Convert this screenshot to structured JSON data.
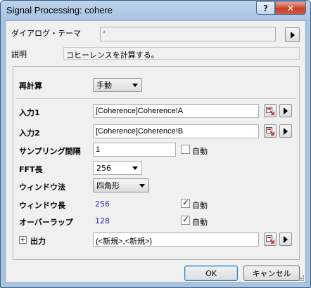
{
  "window": {
    "title": "Signal Processing: cohere",
    "help_glyph": "?",
    "close_glyph": "✕"
  },
  "theme": {
    "label": "ダイアログ・テーマ",
    "value": "*"
  },
  "description": {
    "label": "説明",
    "text": "コヒーレンスを計算する。"
  },
  "recalc": {
    "label": "再計算",
    "value": "手動"
  },
  "input1": {
    "label": "入力1",
    "value": "[Coherence]Coherence!A"
  },
  "input2": {
    "label": "入力2",
    "value": "[Coherence]Coherence!B"
  },
  "sampling": {
    "label": "サンプリング間隔",
    "value": "1",
    "auto_label": "自動",
    "auto_checked": false
  },
  "fft": {
    "label": "FFT長",
    "value": "256"
  },
  "window_method": {
    "label": "ウィンドウ法",
    "value": "四角形"
  },
  "window_length": {
    "label": "ウィンドウ長",
    "value": "256",
    "auto_label": "自動",
    "auto_checked": true
  },
  "overlap": {
    "label": "オーバーラップ",
    "value": "128",
    "auto_label": "自動",
    "auto_checked": true
  },
  "output": {
    "label": "出力",
    "value": "(<新規>,<新規>)"
  },
  "buttons": {
    "ok": "OK",
    "cancel": "キャンセル"
  },
  "colors": {
    "accent_blue": "#1a2fb0",
    "pick_icon_red": "#c0282a"
  }
}
